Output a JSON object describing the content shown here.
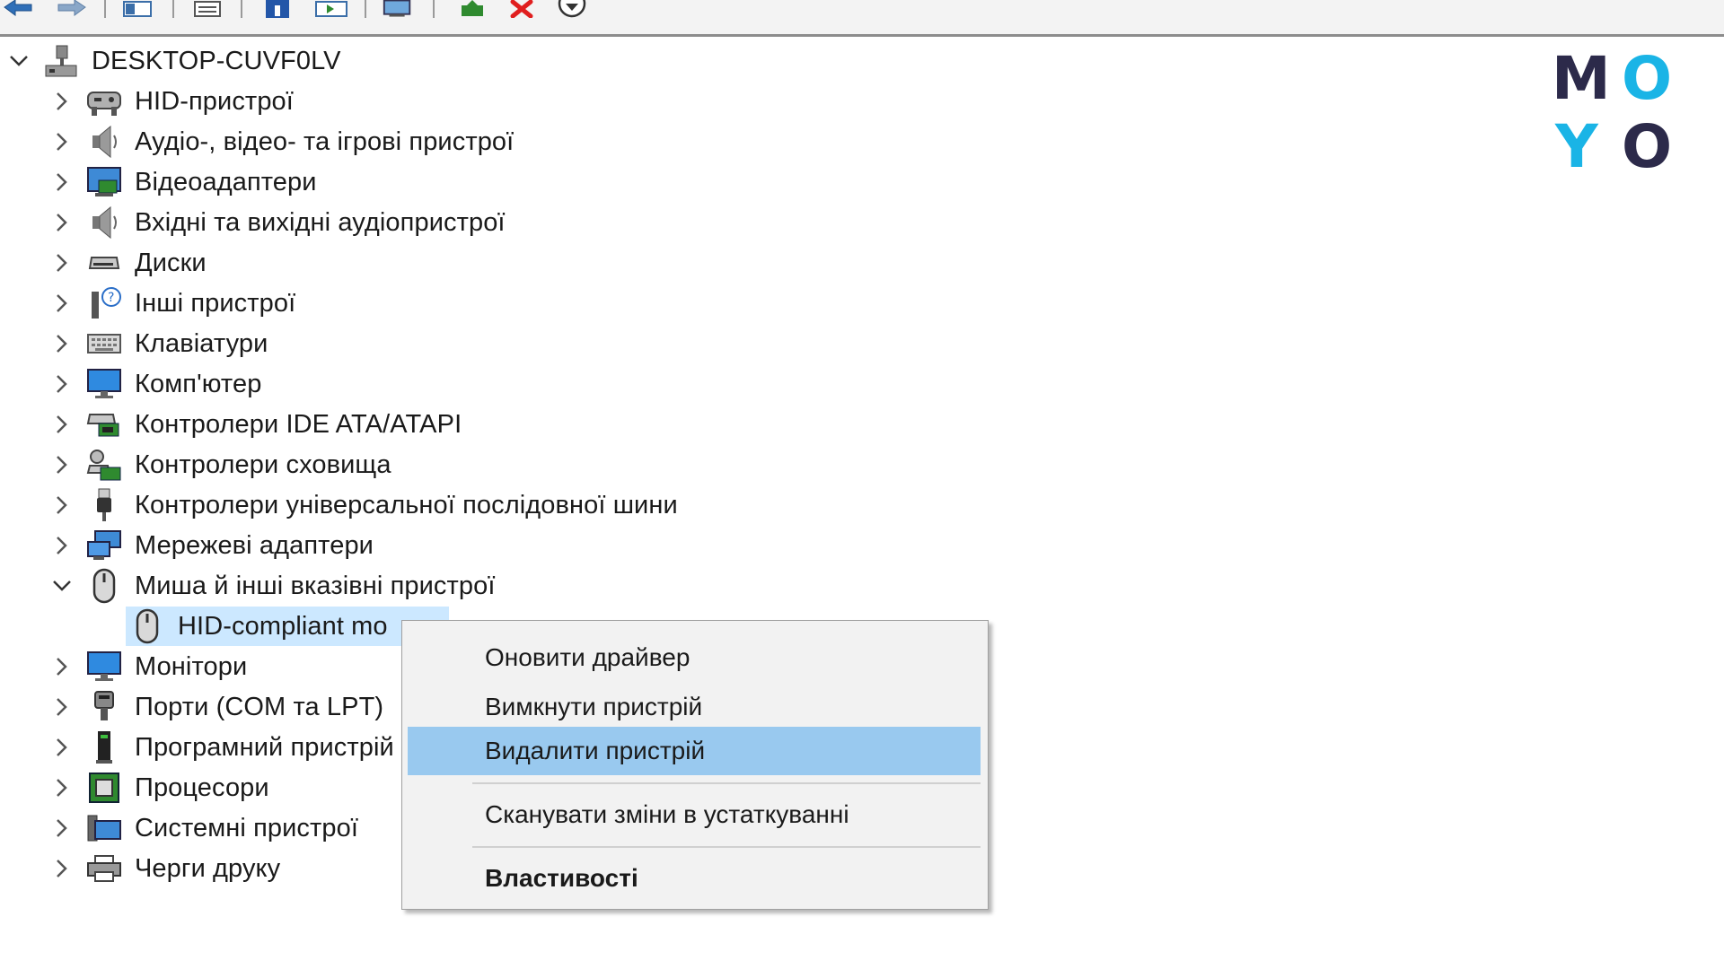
{
  "toolbar": {
    "buttons": [
      {
        "name": "back-arrow-icon"
      },
      {
        "name": "forward-arrow-icon"
      },
      {
        "name": "show-hide-tree-icon"
      },
      {
        "name": "properties-icon"
      },
      {
        "name": "help-icon"
      },
      {
        "name": "action-view-icon"
      },
      {
        "name": "scan-hardware-icon"
      },
      {
        "name": "update-driver-icon"
      },
      {
        "name": "uninstall-red-x-icon"
      },
      {
        "name": "disable-device-icon"
      }
    ]
  },
  "tree": {
    "root": {
      "label": "DESKTOP-CUVF0LV",
      "icon": "computer-network-icon",
      "expanded": true
    },
    "categories": [
      {
        "label": "HID-пристрої",
        "icon": "hid-device-icon"
      },
      {
        "label": "Аудіо-, відео- та ігрові пристрої",
        "icon": "speaker-icon"
      },
      {
        "label": "Відеоадаптери",
        "icon": "display-adapter-icon"
      },
      {
        "label": "Вхідні та вихідні аудіопристрої",
        "icon": "speaker-icon"
      },
      {
        "label": "Диски",
        "icon": "disk-drive-icon"
      },
      {
        "label": "Інші пристрої",
        "icon": "unknown-device-icon"
      },
      {
        "label": "Клавіатури",
        "icon": "keyboard-icon"
      },
      {
        "label": "Комп'ютер",
        "icon": "monitor-icon"
      },
      {
        "label": "Контролери IDE ATA/ATAPI",
        "icon": "ide-controller-icon"
      },
      {
        "label": "Контролери сховища",
        "icon": "storage-controller-icon"
      },
      {
        "label": "Контролери універсальної послідовної шини",
        "icon": "usb-icon"
      },
      {
        "label": "Мережеві адаптери",
        "icon": "network-adapter-icon"
      },
      {
        "label": "Миша й інші вказівні пристрої",
        "icon": "mouse-icon",
        "expanded": true
      },
      {
        "label": "HID-compliant mo",
        "icon": "mouse-icon",
        "child": true,
        "selected": true
      },
      {
        "label": "Монітори",
        "icon": "monitor-icon"
      },
      {
        "label": "Порти (COM та LPT)",
        "icon": "port-icon"
      },
      {
        "label": "Програмний пристрій",
        "icon": "software-device-icon"
      },
      {
        "label": "Процесори",
        "icon": "processor-icon"
      },
      {
        "label": "Системні пристрої",
        "icon": "system-devices-icon"
      },
      {
        "label": "Черги друку",
        "icon": "printer-icon"
      }
    ]
  },
  "context_menu": {
    "items": [
      {
        "label": "Оновити драйвер",
        "name": "menu-item-update-driver"
      },
      {
        "label": "Вимкнути пристрій",
        "name": "menu-item-disable-device"
      },
      {
        "label": "Видалити пристрій",
        "name": "menu-item-uninstall-device",
        "highlighted": true
      },
      {
        "label": "Сканувати зміни в устаткуванні",
        "name": "menu-item-scan-hardware-changes"
      },
      {
        "label": "Властивості",
        "name": "menu-item-properties",
        "bold": true
      }
    ]
  },
  "logo": {
    "letters": [
      "M",
      "O",
      "Y",
      "O"
    ],
    "colors": {
      "dark": "#2c2a4a",
      "accent": "#1ab4e6"
    }
  },
  "colors": {
    "selection_bg": "#cce8ff",
    "menu_highlight": "#99c9ef",
    "menu_bg": "#f2f2f2"
  }
}
